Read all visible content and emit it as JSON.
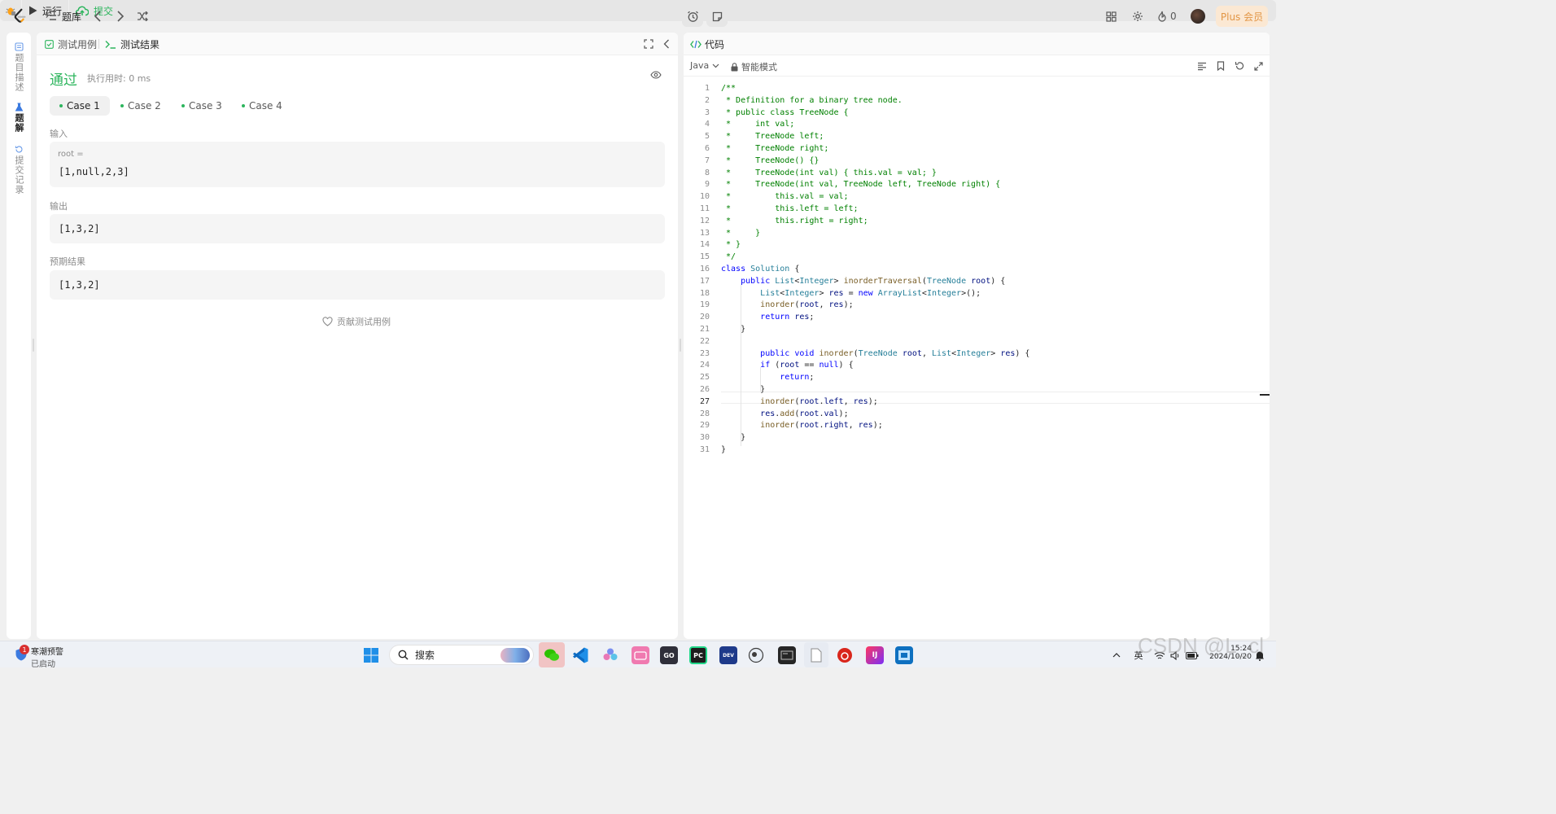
{
  "topbar": {
    "problem_list_label": "题库",
    "run_label": "运行",
    "submit_label": "提交",
    "streak_count": "0",
    "plus_label": "Plus 会员"
  },
  "left_rail": {
    "items": [
      {
        "label": "题目描述"
      },
      {
        "label": "题解"
      },
      {
        "label": "提交记录"
      }
    ]
  },
  "test_panel": {
    "tab_testcase": "测试用例",
    "tab_result": "测试结果",
    "status": "通过",
    "runtime": "执行用时: 0 ms",
    "cases": [
      "Case 1",
      "Case 2",
      "Case 3",
      "Case 4"
    ],
    "input_label": "输入",
    "input_var": "root =",
    "input_value": "[1,null,2,3]",
    "output_label": "输出",
    "output_value": "[1,3,2]",
    "expected_label": "预期结果",
    "expected_value": "[1,3,2]",
    "contribute_label": "贡献测试用例"
  },
  "code_panel": {
    "title": "代码",
    "language": "Java",
    "mode": "智能模式",
    "current_line": 27,
    "lines": [
      "/**",
      " * Definition for a binary tree node.",
      " * public class TreeNode {",
      " *     int val;",
      " *     TreeNode left;",
      " *     TreeNode right;",
      " *     TreeNode() {}",
      " *     TreeNode(int val) { this.val = val; }",
      " *     TreeNode(int val, TreeNode left, TreeNode right) {",
      " *         this.val = val;",
      " *         this.left = left;",
      " *         this.right = right;",
      " *     }",
      " * }",
      " */",
      "class Solution {",
      "    public List<Integer> inorderTraversal(TreeNode root) {",
      "        List<Integer> res = new ArrayList<Integer>();",
      "        inorder(root, res);",
      "        return res;",
      "    }",
      "",
      "        public void inorder(TreeNode root, List<Integer> res) {",
      "        if (root == null) {",
      "            return;",
      "        }",
      "        inorder(root.left, res);",
      "        res.add(root.val);",
      "        inorder(root.right, res);",
      "    }",
      "}"
    ]
  },
  "taskbar": {
    "notification_count": "1",
    "notification_title": "寒潮预警",
    "notification_sub": "已启动",
    "search_label": "搜索",
    "ime_label": "英",
    "time": "15:24",
    "date": "2024/10/20",
    "watermark": "CSDN @L_cl"
  }
}
